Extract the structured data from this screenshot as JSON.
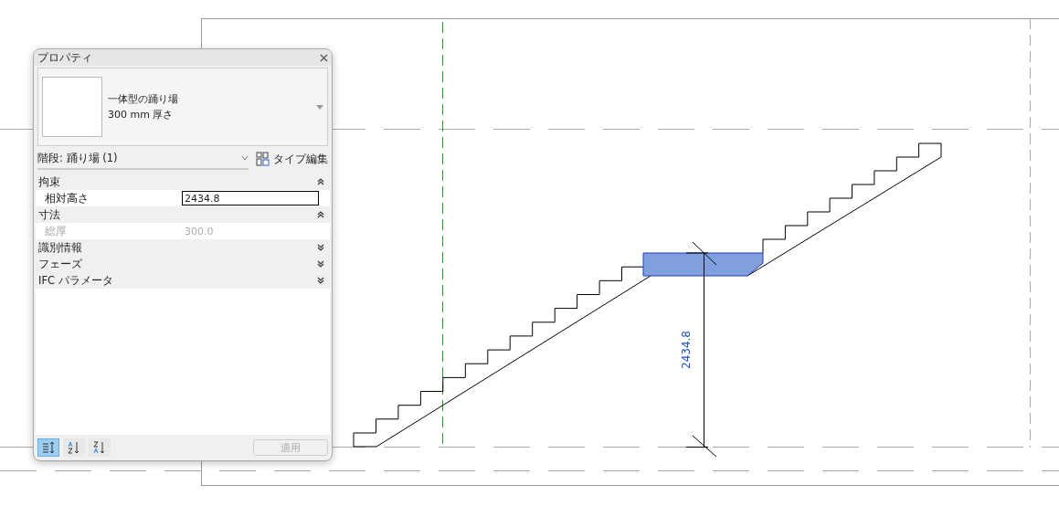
{
  "panel": {
    "title": "プロパティ",
    "type_name": "一体型の踊り場",
    "type_detail": "300 mm 厚さ",
    "instance_filter": "階段: 踊り場 (1)",
    "edit_type_button": "タイプ編集",
    "groups": [
      {
        "label": "拘束",
        "expanded": true,
        "rows": [
          {
            "name": "相対高さ",
            "value": "2434.8",
            "disabled": false,
            "editing": true
          }
        ]
      },
      {
        "label": "寸法",
        "expanded": true,
        "rows": [
          {
            "name": "総厚",
            "value": "300.0",
            "disabled": true,
            "editing": false
          }
        ]
      },
      {
        "label": "識別情報",
        "expanded": false
      },
      {
        "label": "フェーズ",
        "expanded": false
      },
      {
        "label": "IFC パラメータ",
        "expanded": false
      }
    ],
    "sort_buttons": [
      {
        "kind": "category",
        "selected": true
      },
      {
        "kind": "az",
        "selected": false
      },
      {
        "kind": "za",
        "selected": false
      }
    ],
    "apply_button": {
      "label": "適用",
      "disabled": true
    }
  },
  "drawing": {
    "dimension": "2434.8"
  }
}
